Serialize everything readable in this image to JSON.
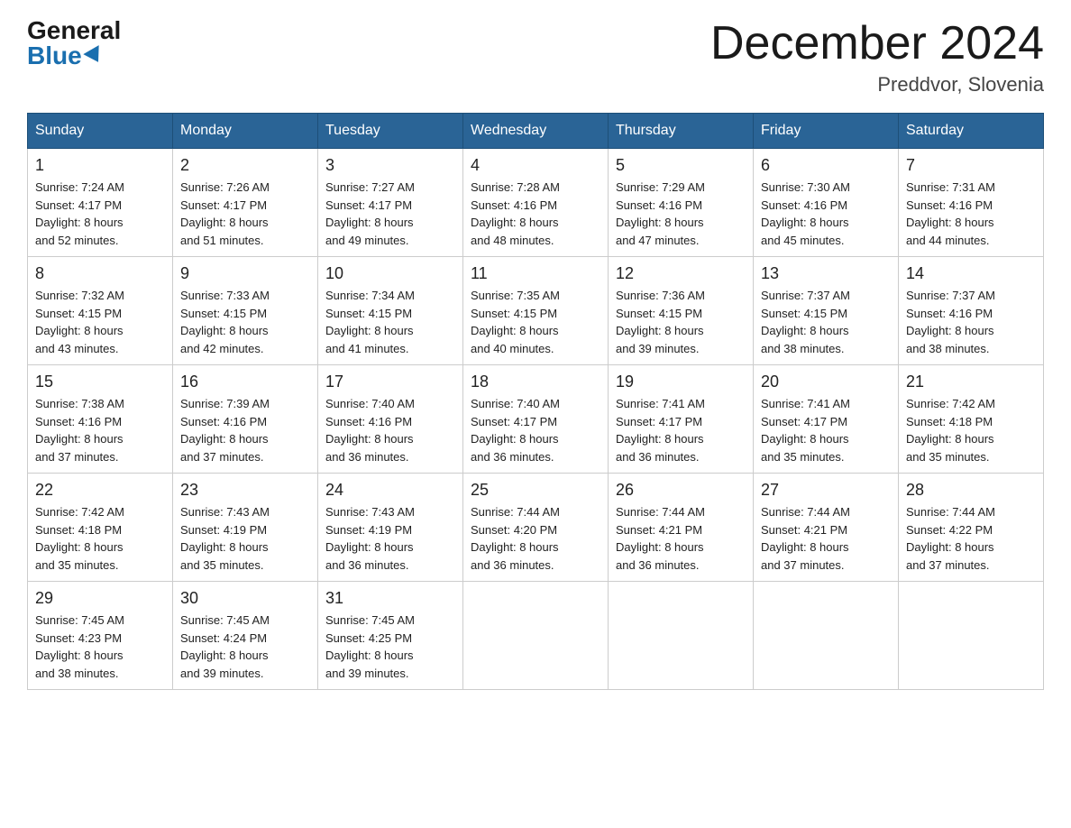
{
  "header": {
    "logo_general": "General",
    "logo_blue": "Blue",
    "month_title": "December 2024",
    "location": "Preddvor, Slovenia"
  },
  "days_of_week": [
    "Sunday",
    "Monday",
    "Tuesday",
    "Wednesday",
    "Thursday",
    "Friday",
    "Saturday"
  ],
  "weeks": [
    [
      {
        "num": "1",
        "sunrise": "7:24 AM",
        "sunset": "4:17 PM",
        "daylight": "8 hours and 52 minutes."
      },
      {
        "num": "2",
        "sunrise": "7:26 AM",
        "sunset": "4:17 PM",
        "daylight": "8 hours and 51 minutes."
      },
      {
        "num": "3",
        "sunrise": "7:27 AM",
        "sunset": "4:17 PM",
        "daylight": "8 hours and 49 minutes."
      },
      {
        "num": "4",
        "sunrise": "7:28 AM",
        "sunset": "4:16 PM",
        "daylight": "8 hours and 48 minutes."
      },
      {
        "num": "5",
        "sunrise": "7:29 AM",
        "sunset": "4:16 PM",
        "daylight": "8 hours and 47 minutes."
      },
      {
        "num": "6",
        "sunrise": "7:30 AM",
        "sunset": "4:16 PM",
        "daylight": "8 hours and 45 minutes."
      },
      {
        "num": "7",
        "sunrise": "7:31 AM",
        "sunset": "4:16 PM",
        "daylight": "8 hours and 44 minutes."
      }
    ],
    [
      {
        "num": "8",
        "sunrise": "7:32 AM",
        "sunset": "4:15 PM",
        "daylight": "8 hours and 43 minutes."
      },
      {
        "num": "9",
        "sunrise": "7:33 AM",
        "sunset": "4:15 PM",
        "daylight": "8 hours and 42 minutes."
      },
      {
        "num": "10",
        "sunrise": "7:34 AM",
        "sunset": "4:15 PM",
        "daylight": "8 hours and 41 minutes."
      },
      {
        "num": "11",
        "sunrise": "7:35 AM",
        "sunset": "4:15 PM",
        "daylight": "8 hours and 40 minutes."
      },
      {
        "num": "12",
        "sunrise": "7:36 AM",
        "sunset": "4:15 PM",
        "daylight": "8 hours and 39 minutes."
      },
      {
        "num": "13",
        "sunrise": "7:37 AM",
        "sunset": "4:15 PM",
        "daylight": "8 hours and 38 minutes."
      },
      {
        "num": "14",
        "sunrise": "7:37 AM",
        "sunset": "4:16 PM",
        "daylight": "8 hours and 38 minutes."
      }
    ],
    [
      {
        "num": "15",
        "sunrise": "7:38 AM",
        "sunset": "4:16 PM",
        "daylight": "8 hours and 37 minutes."
      },
      {
        "num": "16",
        "sunrise": "7:39 AM",
        "sunset": "4:16 PM",
        "daylight": "8 hours and 37 minutes."
      },
      {
        "num": "17",
        "sunrise": "7:40 AM",
        "sunset": "4:16 PM",
        "daylight": "8 hours and 36 minutes."
      },
      {
        "num": "18",
        "sunrise": "7:40 AM",
        "sunset": "4:17 PM",
        "daylight": "8 hours and 36 minutes."
      },
      {
        "num": "19",
        "sunrise": "7:41 AM",
        "sunset": "4:17 PM",
        "daylight": "8 hours and 36 minutes."
      },
      {
        "num": "20",
        "sunrise": "7:41 AM",
        "sunset": "4:17 PM",
        "daylight": "8 hours and 35 minutes."
      },
      {
        "num": "21",
        "sunrise": "7:42 AM",
        "sunset": "4:18 PM",
        "daylight": "8 hours and 35 minutes."
      }
    ],
    [
      {
        "num": "22",
        "sunrise": "7:42 AM",
        "sunset": "4:18 PM",
        "daylight": "8 hours and 35 minutes."
      },
      {
        "num": "23",
        "sunrise": "7:43 AM",
        "sunset": "4:19 PM",
        "daylight": "8 hours and 35 minutes."
      },
      {
        "num": "24",
        "sunrise": "7:43 AM",
        "sunset": "4:19 PM",
        "daylight": "8 hours and 36 minutes."
      },
      {
        "num": "25",
        "sunrise": "7:44 AM",
        "sunset": "4:20 PM",
        "daylight": "8 hours and 36 minutes."
      },
      {
        "num": "26",
        "sunrise": "7:44 AM",
        "sunset": "4:21 PM",
        "daylight": "8 hours and 36 minutes."
      },
      {
        "num": "27",
        "sunrise": "7:44 AM",
        "sunset": "4:21 PM",
        "daylight": "8 hours and 37 minutes."
      },
      {
        "num": "28",
        "sunrise": "7:44 AM",
        "sunset": "4:22 PM",
        "daylight": "8 hours and 37 minutes."
      }
    ],
    [
      {
        "num": "29",
        "sunrise": "7:45 AM",
        "sunset": "4:23 PM",
        "daylight": "8 hours and 38 minutes."
      },
      {
        "num": "30",
        "sunrise": "7:45 AM",
        "sunset": "4:24 PM",
        "daylight": "8 hours and 39 minutes."
      },
      {
        "num": "31",
        "sunrise": "7:45 AM",
        "sunset": "4:25 PM",
        "daylight": "8 hours and 39 minutes."
      },
      null,
      null,
      null,
      null
    ]
  ],
  "labels": {
    "sunrise": "Sunrise:",
    "sunset": "Sunset:",
    "daylight": "Daylight:"
  }
}
